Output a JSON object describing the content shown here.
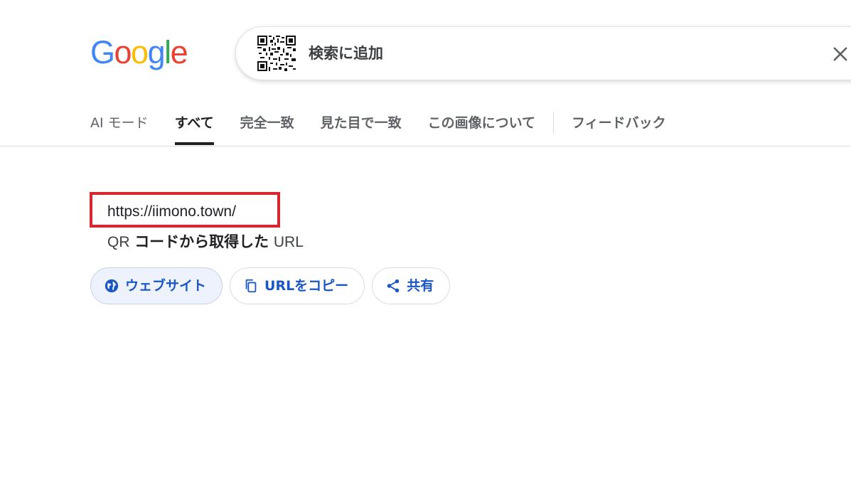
{
  "header": {
    "logo_letters": [
      "G",
      "o",
      "o",
      "g",
      "l",
      "e"
    ],
    "logo_colors": [
      "#4285F4",
      "#EA4335",
      "#FBBC05",
      "#4285F4",
      "#34A853",
      "#EA4335"
    ],
    "search": {
      "image_icon": "qr-code-thumbnail",
      "text": "検索に追加",
      "clear_icon": "close-icon"
    }
  },
  "tabs": [
    {
      "label": "AI モード",
      "active": false
    },
    {
      "label": "すべて",
      "active": true
    },
    {
      "label": "完全一致",
      "active": false
    },
    {
      "label": "見た目で一致",
      "active": false
    },
    {
      "label": "この画像について",
      "active": false
    },
    {
      "label": "フィードバック",
      "active": false
    }
  ],
  "result": {
    "url": "https://iimono.town/",
    "caption_prefix": "QR",
    "caption_bold": "コードから取得した",
    "caption_suffix": "URL",
    "highlight_color": "#d7262e",
    "actions": [
      {
        "label": "ウェブサイト",
        "icon": "globe-icon"
      },
      {
        "label": "URLをコピー",
        "icon": "copy-icon"
      },
      {
        "label": "共有",
        "icon": "share-icon"
      }
    ]
  },
  "colors": {
    "link_blue": "#1a57c4",
    "active_tab": "#202124",
    "muted_text": "#5f6368"
  }
}
